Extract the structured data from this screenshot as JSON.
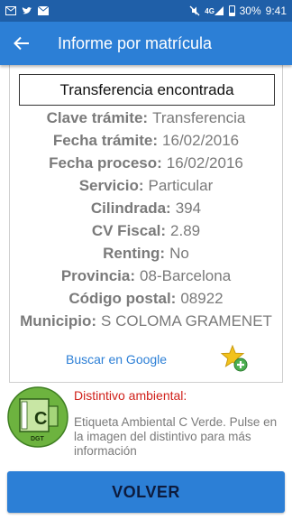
{
  "status_bar": {
    "network_label": "4G",
    "battery": "30%",
    "time": "9:41"
  },
  "app_bar": {
    "title": "Informe por matrícula"
  },
  "record": {
    "status": "Transferencia encontrada",
    "fields": [
      {
        "label": "Clave trámite:",
        "value": "Transferencia"
      },
      {
        "label": "Fecha trámite:",
        "value": "16/02/2016"
      },
      {
        "label": "Fecha proceso:",
        "value": "16/02/2016"
      },
      {
        "label": "Servicio:",
        "value": "Particular"
      },
      {
        "label": "Cilindrada:",
        "value": "394"
      },
      {
        "label": "CV Fiscal:",
        "value": "2.89"
      },
      {
        "label": "Renting:",
        "value": "No"
      },
      {
        "label": "Provincia:",
        "value": "08-Barcelona"
      },
      {
        "label": "Código postal:",
        "value": "08922"
      },
      {
        "label": "Municipio:",
        "value": "S COLOMA GRAMENET"
      }
    ],
    "google_link": "Buscar en Google"
  },
  "distintivo": {
    "title": "Distintivo ambiental:",
    "description": "Etiqueta Ambiental C Verde. Pulse en la imagen del distintivo para más información",
    "badge_letter": "C",
    "badge_logo_text": "DGT"
  },
  "footer": {
    "button_label": "VOLVER"
  },
  "colors": {
    "status_bar": "#1f5fa8",
    "app_bar": "#2c7fd6",
    "link": "#2c7fd6",
    "alert": "#d0201a",
    "badge_green": "#6db33f"
  },
  "icons": [
    "gmail-icon",
    "twitter-icon",
    "mail-icon",
    "mute-icon",
    "signal-icon",
    "battery-icon",
    "back-arrow-icon",
    "favorite-add-icon",
    "environmental-badge-icon"
  ]
}
